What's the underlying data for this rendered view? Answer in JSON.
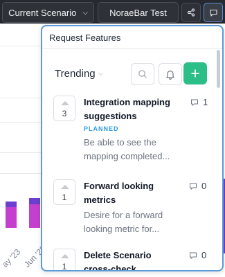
{
  "toolbar": {
    "scenario_label": "Current Scenario",
    "project_label": "NoraeBar Test"
  },
  "panel": {
    "title": "Request Features",
    "sort_value": "Trending"
  },
  "items": [
    {
      "votes": "3",
      "title": "Integration mapping suggestions",
      "badge": "PLANNED",
      "description": "Be able to see the mapping completed...",
      "comments": "1"
    },
    {
      "votes": "1",
      "title": "Forward looking metrics",
      "description": "Desire for a forward looking metric for...",
      "comments": "0"
    },
    {
      "votes": "1",
      "title": "Delete Scenario cross-check",
      "comments": "0"
    }
  ],
  "background_chart": {
    "x_ticks": [
      "ay '23",
      "Jun '23"
    ],
    "colors": {
      "primary": "#c53fcf",
      "secondary": "#6b3fcf"
    }
  },
  "colors": {
    "accent_green": "#2bbf87",
    "badge_blue": "#2f9be0",
    "topbar": "#26292f",
    "focus_border": "#5b9bd8"
  }
}
